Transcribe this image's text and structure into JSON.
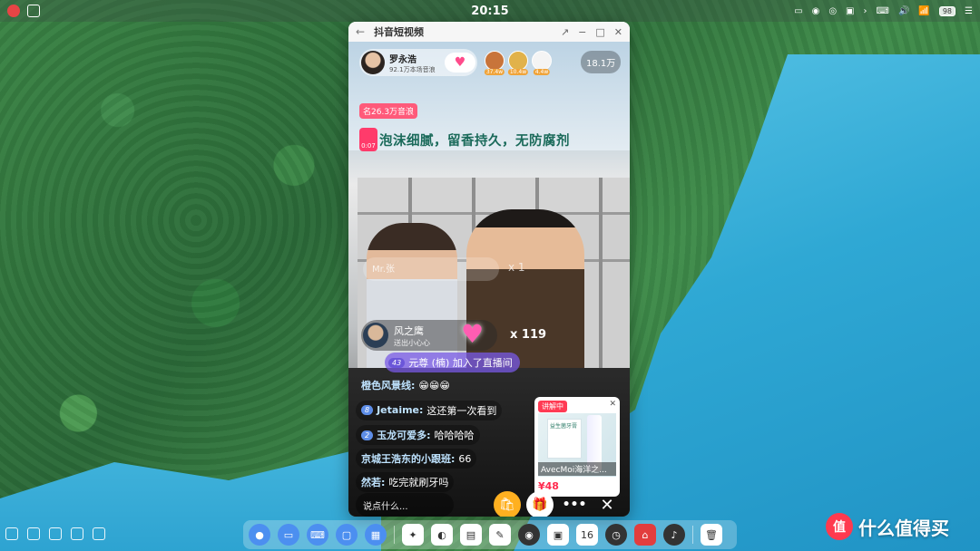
{
  "statusbar": {
    "time": "20:15",
    "battery": "98"
  },
  "window": {
    "title": "抖音短视频"
  },
  "live": {
    "host_name": "罗永浩",
    "host_sub": "92.1万本场音浪",
    "viewer_badges": [
      "37.4w",
      "10.4w",
      "4.4w"
    ],
    "viewer_count": "18.1万",
    "rank": "名26.3万音浪",
    "promo_timer": "0:07",
    "promo_text": "泡沫细腻，留香持久，无防腐剂",
    "ghost_gift_name": "Mr.张",
    "ghost_gift_count": "x 1",
    "gift_sender": "风之鹰",
    "gift_sub": "送出小心心",
    "gift_count": "x 119",
    "join_level": "43",
    "join_text": "元尊 (楠) 加入了直播间",
    "comments": [
      {
        "level": "",
        "user": "橙色风景线:",
        "text": "😁😁😁"
      },
      {
        "level": "8",
        "user": "Jetaime:",
        "text": "这还第一次看到"
      },
      {
        "level": "2",
        "user": "玉龙可爱多:",
        "text": "哈哈哈哈"
      },
      {
        "level": "",
        "user": "京城王浩东的小跟班:",
        "text": "66"
      },
      {
        "level": "",
        "user": "然若:",
        "text": "吃完就刷牙吗"
      }
    ],
    "product": {
      "tag": "讲解中",
      "box_text": "益生菌牙膏",
      "name": "AvecMoi海洋之...",
      "price": "¥48"
    },
    "input_placeholder": "说点什么..."
  },
  "watermark": {
    "badge": "值",
    "text": "什么值得买"
  },
  "calendar_day": "16"
}
